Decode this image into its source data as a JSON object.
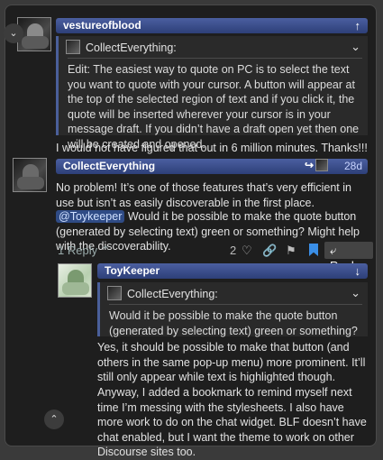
{
  "post1": {
    "username": "vestureofblood",
    "quote": {
      "author": "CollectEverything:",
      "text": "Edit: The easiest way to quote on PC is to select the text you want to quote with your cursor. A button will appear at the top of the selected region of text and if you click it, the quote will be inserted wherever your cursor is in your message draft. If you didn’t have a draft open yet then one will be created and opened."
    },
    "body": "I would not have figured that out in 6 million minutes. Thanks!!!"
  },
  "post2": {
    "username": "CollectEverything",
    "age": "28d",
    "body1": "No problem! It’s one of those features that’s very efficient in use but isn’t as easily discoverable in the first place.",
    "mention": "@Toykeeper",
    "body2": " Would it be possible to make the quote button (generated by selecting text) green or something? Might help with the discoverability.",
    "replies_label": "1 Reply",
    "likes": "2",
    "reply_label": "Reply"
  },
  "post3": {
    "username": "ToyKeeper",
    "quote": {
      "author": "CollectEverything:",
      "text": "Would it be possible to make the quote button (generated by selecting text) green or something?"
    },
    "body1": "Yes, it should be possible to make that button (and others in the same pop-up menu) more prominent. It’ll still only appear while text is highlighted though.",
    "body2": "Anyway, I added a bookmark to remind myself next time I’m messing with the stylesheets. I also have more work to do on the chat widget. BLF doesn’t have chat enabled, but I want the theme to work on other Discourse sites too."
  }
}
